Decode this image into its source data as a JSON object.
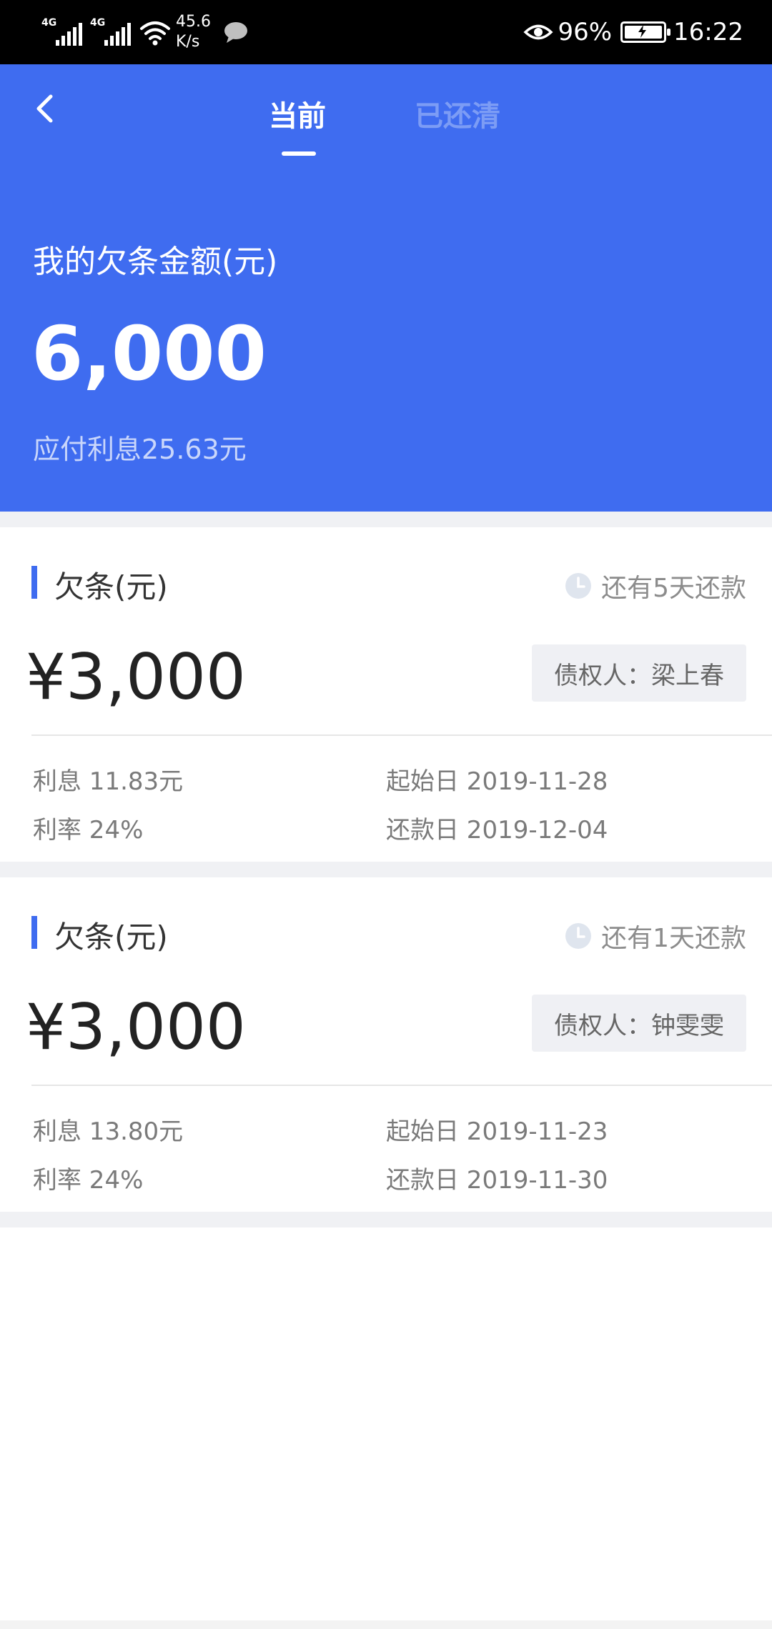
{
  "status_bar": {
    "signal1_label": "4G",
    "signal2_label": "4G",
    "speed_value": "45.6",
    "speed_unit": "K/s",
    "battery_percent": "96%",
    "time": "16:22"
  },
  "header": {
    "tabs": [
      {
        "label": "当前",
        "active": true
      },
      {
        "label": "已还清",
        "active": false
      }
    ]
  },
  "summary": {
    "label": "我的欠条金额(元)",
    "amount": "6,000",
    "interest_text": "应付利息25.63元"
  },
  "notes": [
    {
      "title": "欠条(元)",
      "due_text": "还有5天还款",
      "amount": "¥3,000",
      "creditor": "债权人：梁上春",
      "interest": "利息 11.83元",
      "rate": "利率 24%",
      "start_date": "起始日 2019-11-28",
      "repay_date": "还款日 2019-12-04"
    },
    {
      "title": "欠条(元)",
      "due_text": "还有1天还款",
      "amount": "¥3,000",
      "creditor": "债权人：钟雯雯",
      "interest": "利息 13.80元",
      "rate": "利率 24%",
      "start_date": "起始日 2019-11-23",
      "repay_date": "还款日 2019-11-30"
    }
  ],
  "colors": {
    "brand_blue": "#3f6cf0",
    "inactive_tab": "#7c9cf5",
    "page_gap": "#f0f1f4"
  },
  "icons": [
    "back-arrow-icon",
    "clock-icon",
    "eye-icon",
    "battery-icon",
    "wifi-icon",
    "signal-icon",
    "chat-bubble-icon"
  ]
}
